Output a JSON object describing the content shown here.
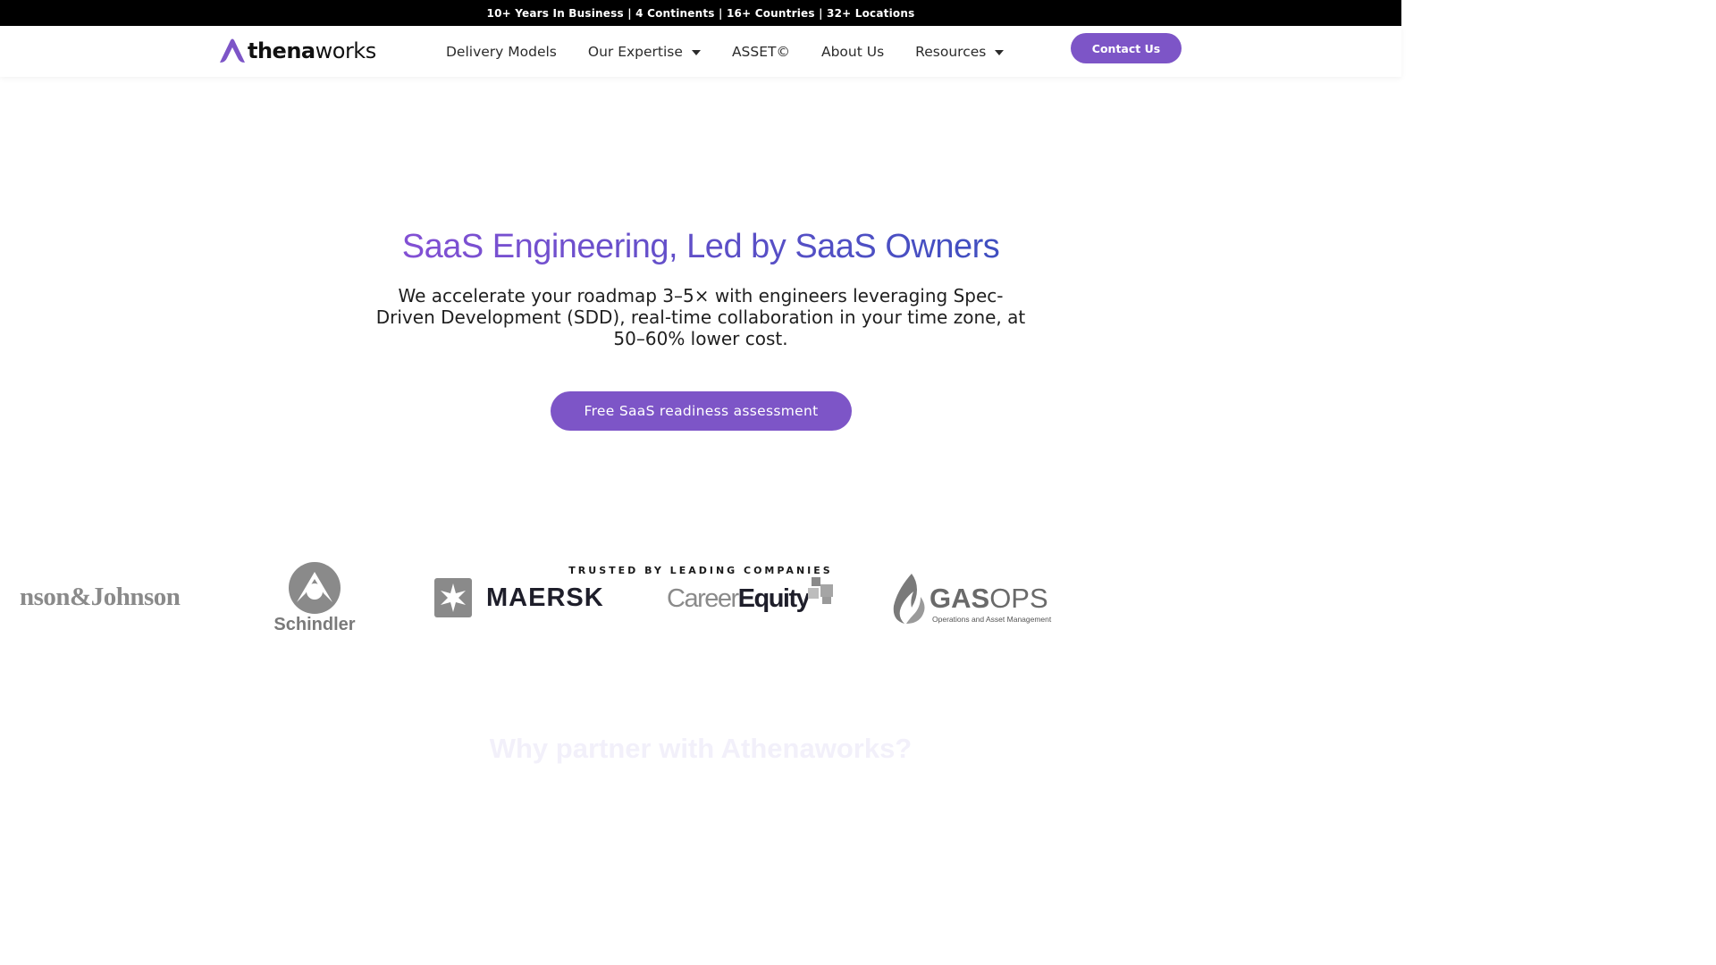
{
  "topbar": {
    "text": "10+ Years In Business | 4 Continents | 16+ Countries | 32+ Locations"
  },
  "header": {
    "logo": {
      "bold_part": "thena",
      "light_part": "works"
    },
    "nav": [
      {
        "label": "Delivery Models",
        "has_dropdown": false
      },
      {
        "label": "Our Expertise",
        "has_dropdown": true
      },
      {
        "label": "ASSET©",
        "has_dropdown": false
      },
      {
        "label": "About Us",
        "has_dropdown": false
      },
      {
        "label": "Resources",
        "has_dropdown": true
      }
    ],
    "contact_label": "Contact Us"
  },
  "hero": {
    "title": "SaaS Engineering, Led by SaaS Owners",
    "subtitle": "We accelerate your roadmap 3–5× with engineers leveraging Spec-Driven Development (SDD), real-time collaboration in your time zone, at 50–60% lower cost.",
    "cta_label": "Free SaaS readiness assessment"
  },
  "trusted": {
    "label": "TRUSTED BY LEADING COMPANIES",
    "logos": {
      "johnson": "nson&Johnson",
      "schindler": "Schindler",
      "maersk": "MAERSK",
      "career_part1": "Career",
      "career_part2": "Equity",
      "gasops_bold": "GAS",
      "gasops_light": "OPS",
      "gasops_sub": "Operations and Asset Management"
    }
  },
  "section": {
    "heading": "Why partner with Athenaworks?"
  },
  "colors": {
    "accent": "#7d55c7",
    "title_gradient_start": "#8350d4",
    "title_gradient_end": "#3f4fc0",
    "topbar_bg": "#000000"
  }
}
